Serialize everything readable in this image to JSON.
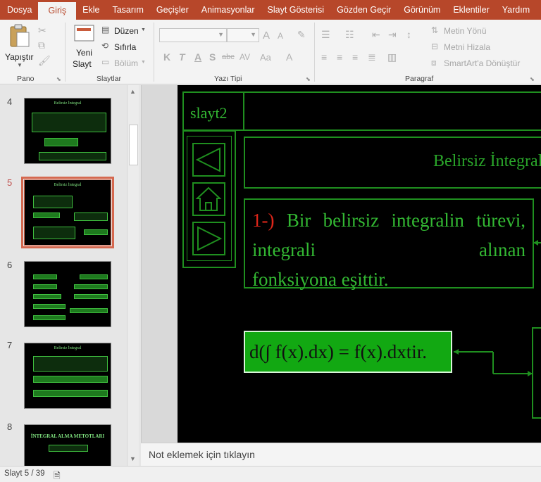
{
  "ribbon_tabs": [
    "Dosya",
    "Giriş",
    "Ekle",
    "Tasarım",
    "Geçişler",
    "Animasyonlar",
    "Slayt Gösterisi",
    "Gözden Geçir",
    "Görünüm",
    "Eklentiler",
    "Yardım"
  ],
  "active_tab": "Giriş",
  "ribbon": {
    "pano": {
      "label": "Pano",
      "paste": "Yapıştır"
    },
    "slaytlar": {
      "label": "Slaytlar",
      "new_slide_line1": "Yeni",
      "new_slide_line2": "Slayt",
      "layout": "Düzen",
      "reset": "Sıfırla",
      "section": "Bölüm"
    },
    "yazi_tipi": {
      "label": "Yazı Tipi",
      "increase_font": "A",
      "decrease_font": "A",
      "bold": "K",
      "italic": "T",
      "underline": "A",
      "shadow": "S",
      "strike": "abc",
      "spacing": "AV",
      "case": "Aa",
      "font_color": "A"
    },
    "paragraf": {
      "label": "Paragraf",
      "text_direction": "Metin Yönü",
      "align_text": "Metni Hizala",
      "smartart": "SmartArt'a Dönüştür"
    }
  },
  "thumbnails": [
    {
      "number": "4",
      "title": "Belirsiz İntegral",
      "selected": false
    },
    {
      "number": "5",
      "title": "Belirsiz İntegral",
      "selected": true
    },
    {
      "number": "6",
      "title": "",
      "selected": false
    },
    {
      "number": "7",
      "title": "Belirsiz İntegral",
      "selected": false
    },
    {
      "number": "8",
      "title": "İNTEGRAL ALMA METOTLARI",
      "selected": false
    }
  ],
  "slide": {
    "label": "slayt2",
    "title": "Belirsiz İntegral",
    "body_number": "1-)",
    "body_text_line1": "Bir belirsiz integralin",
    "body_text_line2": "türevi, integrali alınan",
    "body_text_line3": "fonksiyona eşittir.",
    "formula": "d(∫ f(x).dx) = f(x).dxtir."
  },
  "notes_placeholder": "Not eklemek için tıklayın",
  "status": {
    "slide_position": "Slayt 5 / 39"
  },
  "colors": {
    "ribbon_accent": "#b7472a",
    "slide_green": "#33b833",
    "slide_red": "#e0261a",
    "formula_bg": "#12a812"
  }
}
